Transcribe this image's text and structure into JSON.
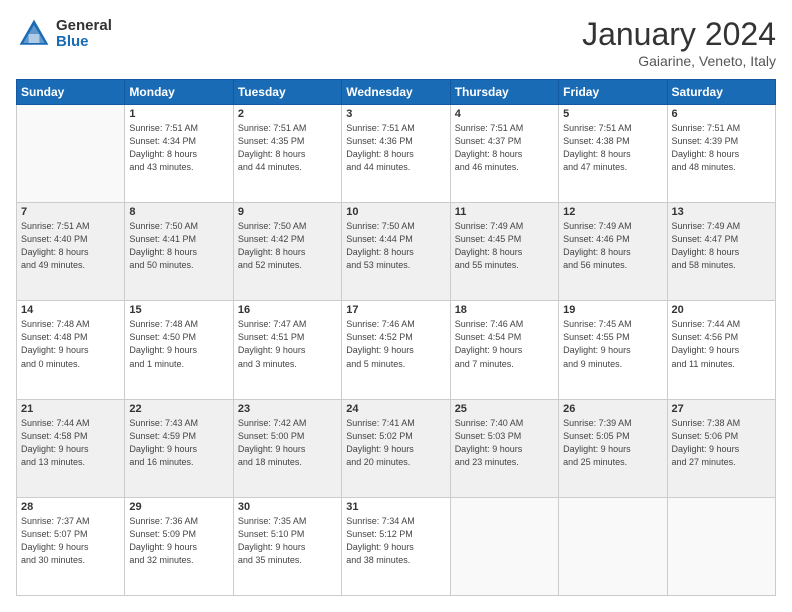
{
  "header": {
    "logo_general": "General",
    "logo_blue": "Blue",
    "month_title": "January 2024",
    "location": "Gaiarine, Veneto, Italy"
  },
  "days_of_week": [
    "Sunday",
    "Monday",
    "Tuesday",
    "Wednesday",
    "Thursday",
    "Friday",
    "Saturday"
  ],
  "weeks": [
    [
      {
        "day": "",
        "info": ""
      },
      {
        "day": "1",
        "info": "Sunrise: 7:51 AM\nSunset: 4:34 PM\nDaylight: 8 hours\nand 43 minutes."
      },
      {
        "day": "2",
        "info": "Sunrise: 7:51 AM\nSunset: 4:35 PM\nDaylight: 8 hours\nand 44 minutes."
      },
      {
        "day": "3",
        "info": "Sunrise: 7:51 AM\nSunset: 4:36 PM\nDaylight: 8 hours\nand 44 minutes."
      },
      {
        "day": "4",
        "info": "Sunrise: 7:51 AM\nSunset: 4:37 PM\nDaylight: 8 hours\nand 46 minutes."
      },
      {
        "day": "5",
        "info": "Sunrise: 7:51 AM\nSunset: 4:38 PM\nDaylight: 8 hours\nand 47 minutes."
      },
      {
        "day": "6",
        "info": "Sunrise: 7:51 AM\nSunset: 4:39 PM\nDaylight: 8 hours\nand 48 minutes."
      }
    ],
    [
      {
        "day": "7",
        "info": "Sunrise: 7:51 AM\nSunset: 4:40 PM\nDaylight: 8 hours\nand 49 minutes."
      },
      {
        "day": "8",
        "info": "Sunrise: 7:50 AM\nSunset: 4:41 PM\nDaylight: 8 hours\nand 50 minutes."
      },
      {
        "day": "9",
        "info": "Sunrise: 7:50 AM\nSunset: 4:42 PM\nDaylight: 8 hours\nand 52 minutes."
      },
      {
        "day": "10",
        "info": "Sunrise: 7:50 AM\nSunset: 4:44 PM\nDaylight: 8 hours\nand 53 minutes."
      },
      {
        "day": "11",
        "info": "Sunrise: 7:49 AM\nSunset: 4:45 PM\nDaylight: 8 hours\nand 55 minutes."
      },
      {
        "day": "12",
        "info": "Sunrise: 7:49 AM\nSunset: 4:46 PM\nDaylight: 8 hours\nand 56 minutes."
      },
      {
        "day": "13",
        "info": "Sunrise: 7:49 AM\nSunset: 4:47 PM\nDaylight: 8 hours\nand 58 minutes."
      }
    ],
    [
      {
        "day": "14",
        "info": "Sunrise: 7:48 AM\nSunset: 4:48 PM\nDaylight: 9 hours\nand 0 minutes."
      },
      {
        "day": "15",
        "info": "Sunrise: 7:48 AM\nSunset: 4:50 PM\nDaylight: 9 hours\nand 1 minute."
      },
      {
        "day": "16",
        "info": "Sunrise: 7:47 AM\nSunset: 4:51 PM\nDaylight: 9 hours\nand 3 minutes."
      },
      {
        "day": "17",
        "info": "Sunrise: 7:46 AM\nSunset: 4:52 PM\nDaylight: 9 hours\nand 5 minutes."
      },
      {
        "day": "18",
        "info": "Sunrise: 7:46 AM\nSunset: 4:54 PM\nDaylight: 9 hours\nand 7 minutes."
      },
      {
        "day": "19",
        "info": "Sunrise: 7:45 AM\nSunset: 4:55 PM\nDaylight: 9 hours\nand 9 minutes."
      },
      {
        "day": "20",
        "info": "Sunrise: 7:44 AM\nSunset: 4:56 PM\nDaylight: 9 hours\nand 11 minutes."
      }
    ],
    [
      {
        "day": "21",
        "info": "Sunrise: 7:44 AM\nSunset: 4:58 PM\nDaylight: 9 hours\nand 13 minutes."
      },
      {
        "day": "22",
        "info": "Sunrise: 7:43 AM\nSunset: 4:59 PM\nDaylight: 9 hours\nand 16 minutes."
      },
      {
        "day": "23",
        "info": "Sunrise: 7:42 AM\nSunset: 5:00 PM\nDaylight: 9 hours\nand 18 minutes."
      },
      {
        "day": "24",
        "info": "Sunrise: 7:41 AM\nSunset: 5:02 PM\nDaylight: 9 hours\nand 20 minutes."
      },
      {
        "day": "25",
        "info": "Sunrise: 7:40 AM\nSunset: 5:03 PM\nDaylight: 9 hours\nand 23 minutes."
      },
      {
        "day": "26",
        "info": "Sunrise: 7:39 AM\nSunset: 5:05 PM\nDaylight: 9 hours\nand 25 minutes."
      },
      {
        "day": "27",
        "info": "Sunrise: 7:38 AM\nSunset: 5:06 PM\nDaylight: 9 hours\nand 27 minutes."
      }
    ],
    [
      {
        "day": "28",
        "info": "Sunrise: 7:37 AM\nSunset: 5:07 PM\nDaylight: 9 hours\nand 30 minutes."
      },
      {
        "day": "29",
        "info": "Sunrise: 7:36 AM\nSunset: 5:09 PM\nDaylight: 9 hours\nand 32 minutes."
      },
      {
        "day": "30",
        "info": "Sunrise: 7:35 AM\nSunset: 5:10 PM\nDaylight: 9 hours\nand 35 minutes."
      },
      {
        "day": "31",
        "info": "Sunrise: 7:34 AM\nSunset: 5:12 PM\nDaylight: 9 hours\nand 38 minutes."
      },
      {
        "day": "",
        "info": ""
      },
      {
        "day": "",
        "info": ""
      },
      {
        "day": "",
        "info": ""
      }
    ]
  ]
}
